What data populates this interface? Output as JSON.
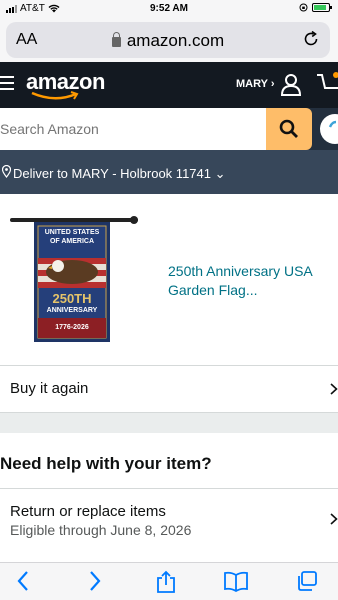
{
  "status_bar": {
    "carrier": "AT&T",
    "time": "9:52 AM"
  },
  "browser": {
    "text_size_label": "AA",
    "url": "amazon.com"
  },
  "header": {
    "logo": "amazon",
    "account_label": "MARY ›"
  },
  "search": {
    "placeholder": "Search Amazon"
  },
  "delivery": {
    "text": "Deliver to MARY - Holbrook 11741 ⌄"
  },
  "product": {
    "title": "250th Anniversary USA Garden Flag...",
    "flag_top": "UNITED STATES OF AMERICA",
    "flag_mid": "ANNIVERSARY",
    "flag_years": "1776-2026",
    "flag_num": "250TH"
  },
  "buy_again": {
    "label": "Buy it again"
  },
  "help": {
    "heading": "Need help with your item?"
  },
  "return_option": {
    "label": "Return or replace items",
    "eligibility": "Eligible through June 8, 2026"
  },
  "colors": {
    "header_bg": "#131921",
    "search_btn": "#febd69",
    "deliver_bg": "#37475a",
    "link": "#007185",
    "safari_blue": "#007aff"
  }
}
